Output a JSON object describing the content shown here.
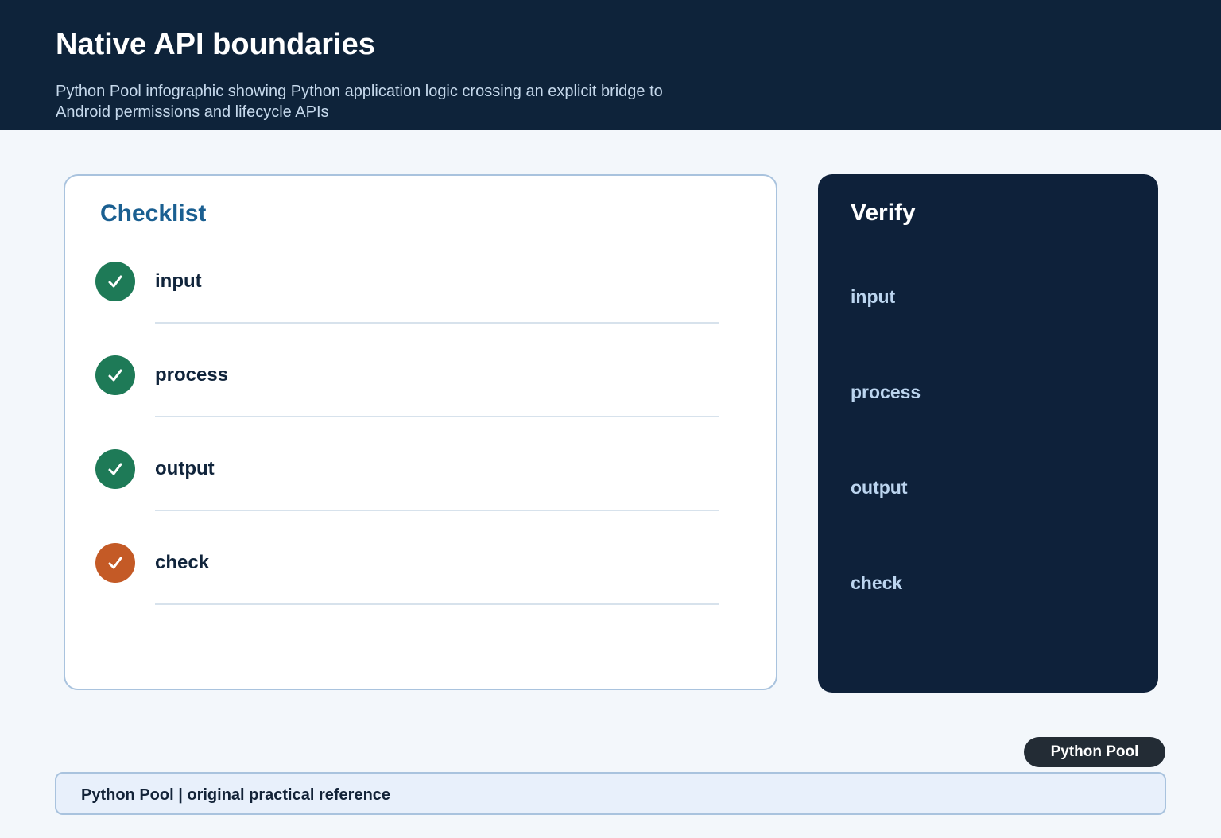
{
  "header": {
    "title": "Native API boundaries",
    "subtitle": "Python Pool infographic showing Python application logic crossing an explicit bridge to Android permissions and lifecycle APIs"
  },
  "checklist": {
    "title": "Checklist",
    "items": [
      {
        "label": "input",
        "status": "done",
        "color": "#1e7a57"
      },
      {
        "label": "process",
        "status": "done",
        "color": "#1e7a57"
      },
      {
        "label": "output",
        "status": "done",
        "color": "#1e7a57"
      },
      {
        "label": "check",
        "status": "attention",
        "color": "#c45a26"
      }
    ]
  },
  "verify": {
    "title": "Verify",
    "items": [
      "input",
      "process",
      "output",
      "check"
    ]
  },
  "badge": {
    "label": "Python Pool"
  },
  "footer": {
    "text": "Python Pool | original practical reference"
  },
  "colors": {
    "header_bg": "#0e233a",
    "accent_blue": "#1a5f91",
    "done_green": "#1e7a57",
    "warn_orange": "#c45a26"
  }
}
